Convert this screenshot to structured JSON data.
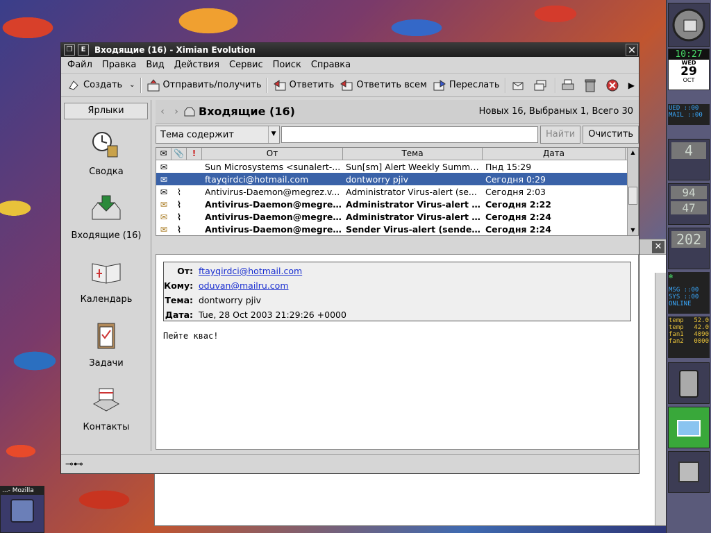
{
  "window": {
    "title": "Входящие (16) - Ximian Evolution",
    "menu_btn": "E"
  },
  "menu": [
    {
      "label": "Файл"
    },
    {
      "label": "Правка"
    },
    {
      "label": "Вид"
    },
    {
      "label": "Действия"
    },
    {
      "label": "Сервис"
    },
    {
      "label": "Поиск"
    },
    {
      "label": "Справка"
    }
  ],
  "toolbar": {
    "create": "Создать",
    "send_receive": "Отправить/получить",
    "reply": "Ответить",
    "reply_all": "Ответить всем",
    "forward": "Переслать"
  },
  "sidebar": {
    "header": "Ярлыки",
    "items": [
      {
        "label": "Сводка"
      },
      {
        "label": "Входящие (16)"
      },
      {
        "label": "Календарь"
      },
      {
        "label": "Задачи"
      },
      {
        "label": "Контакты"
      }
    ]
  },
  "folder": {
    "name": "Входящие (16)",
    "counts": "Новых 16, Выбраных 1, Всего 30"
  },
  "search": {
    "criteria": "Тема содержит",
    "value": "",
    "find": "Найти",
    "clear": "Очистить"
  },
  "columns": {
    "from": "От",
    "subject": "Тема",
    "date": "Дата"
  },
  "messages": [
    {
      "from": "Sun Microsystems <sunalert-...",
      "subject": "Sun[sm] Alert Weekly Summa...",
      "date": "Пнд 15:29",
      "attach": false,
      "unread": false
    },
    {
      "from": "ftayqirdci@hotmail.com",
      "subject": "dontworry pjiv",
      "date": "Сегодня 0:29",
      "attach": false,
      "unread": false
    },
    {
      "from": "Antivirus-Daemon@megrez.v...",
      "subject": "Administrator Virus-alert (se...",
      "date": "Сегодня 2:03",
      "attach": true,
      "unread": false
    },
    {
      "from": "Antivirus-Daemon@megrez...",
      "subject": "Administrator Virus-alert (s...",
      "date": "Сегодня 2:22",
      "attach": true,
      "unread": true
    },
    {
      "from": "Antivirus-Daemon@megrez...",
      "subject": "Administrator Virus-alert (s...",
      "date": "Сегодня 2:24",
      "attach": true,
      "unread": true
    },
    {
      "from": "Antivirus-Daemon@megrez...",
      "subject": "Sender Virus-alert (sender: ...",
      "date": "Сегодня 2:24",
      "attach": true,
      "unread": true
    }
  ],
  "preview": {
    "from_label": "От:",
    "from": "ftayqirdci@hotmail.com",
    "to_label": "Кому:",
    "to": "oduvan@mailru.com",
    "subject_label": "Тема:",
    "subject": "dontworry pjiv",
    "date_label": "Дата:",
    "date": "Tue, 28 Oct 2003 21:29:26 +0000",
    "body": "Пейте квас!"
  },
  "dock": {
    "clock": "10:27",
    "day": "WED",
    "date": "29",
    "month": "OCT",
    "mail_lines": [
      "UED ::00",
      "MAIL ::00"
    ],
    "cpu": "4",
    "mem1": "94",
    "mem2": "47",
    "net": "202",
    "icq": [
      "MSG ::00",
      "SYS ::00",
      "ONLINE"
    ],
    "sensors": [
      {
        "label": "temp",
        "value": "52.0"
      },
      {
        "label": "temp",
        "value": "42.0"
      },
      {
        "label": "fan1",
        "value": "4090"
      },
      {
        "label": "fan2",
        "value": "0000"
      }
    ]
  },
  "taskbar": {
    "mozilla": "...- Mozilla"
  },
  "colors": {
    "selection": "#3a62a8",
    "link": "#1a2fd0",
    "titlebar": "#1e1e1e"
  }
}
